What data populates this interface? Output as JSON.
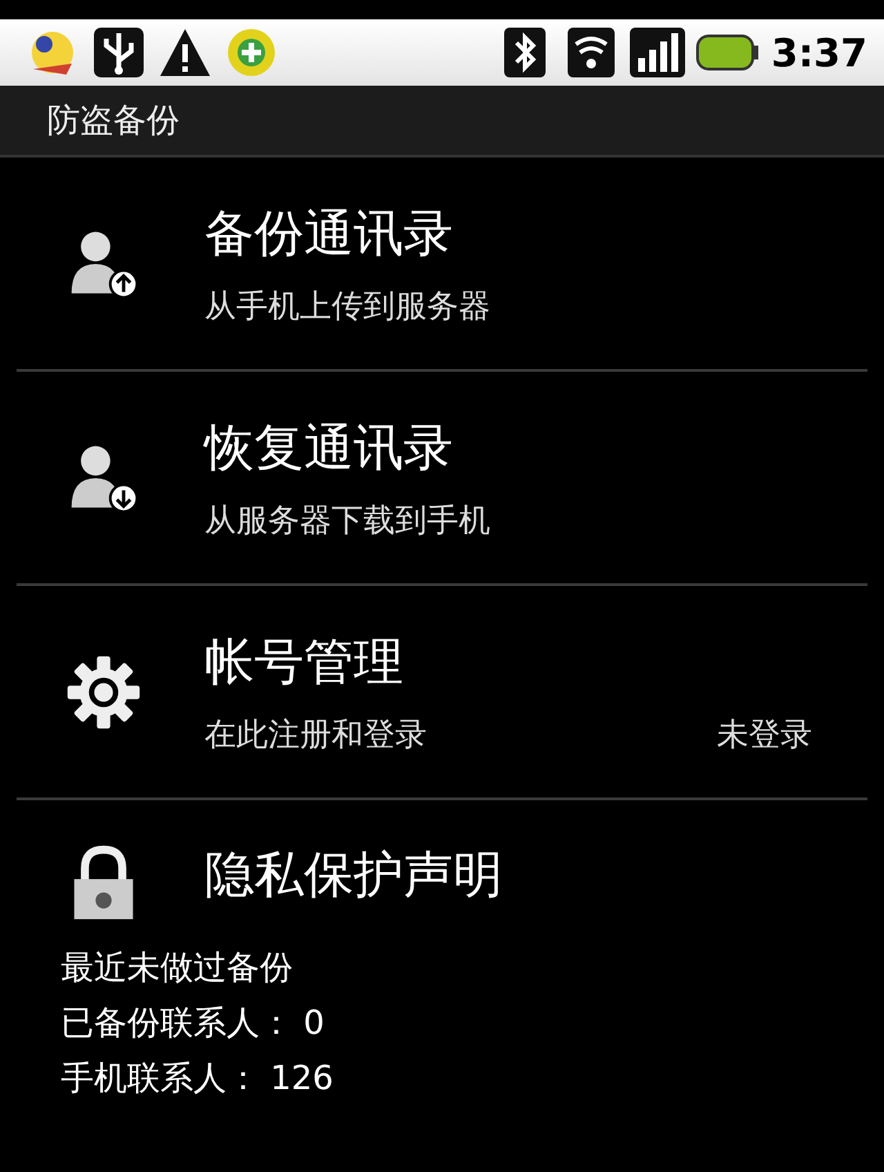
{
  "status_bar": {
    "time": "3:37"
  },
  "title_bar": {
    "title": "防盗备份"
  },
  "menu_items": [
    {
      "title": "备份通讯录",
      "subtitle": "从手机上传到服务器"
    },
    {
      "title": "恢复通讯录",
      "subtitle": "从服务器下载到手机"
    },
    {
      "title": "帐号管理",
      "subtitle": "在此注册和登录",
      "status": "未登录"
    },
    {
      "title": "隐私保护声明"
    }
  ],
  "backup_info": [
    "最近未做过备份",
    "已备份联系人：  0",
    "手机联系人：  126"
  ]
}
